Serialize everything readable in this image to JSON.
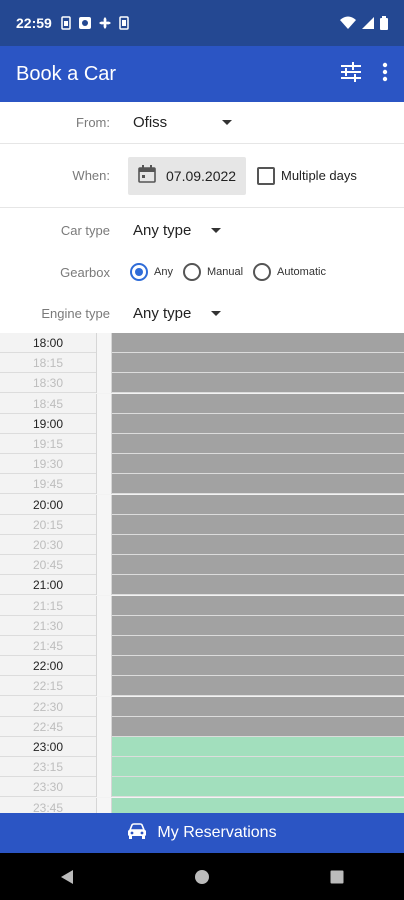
{
  "status_bar": {
    "time": "22:59"
  },
  "app_bar": {
    "title": "Book a Car",
    "filter_icon": "tune-icon",
    "menu_icon": "more-vert-icon"
  },
  "form": {
    "from_label": "From:",
    "from_value": "Ofiss",
    "when_label": "When:",
    "date_value": "07.09.2022",
    "multiple_days_label": "Multiple days",
    "car_type_label": "Car type",
    "car_type_value": "Any type",
    "gearbox_label": "Gearbox",
    "gearbox_options": [
      "Any",
      "Manual",
      "Automatic"
    ],
    "gearbox_selected": "Any",
    "engine_type_label": "Engine type",
    "engine_type_value": "Any type"
  },
  "schedule": {
    "colors": {
      "busy": "#a2a2a2",
      "free": "#a2dfbd"
    },
    "slots": [
      {
        "time": "18:00",
        "status": "busy"
      },
      {
        "time": "18:15",
        "status": "busy"
      },
      {
        "time": "18:30",
        "status": "busy"
      },
      {
        "time": "18:45",
        "status": "busy"
      },
      {
        "time": "19:00",
        "status": "busy"
      },
      {
        "time": "19:15",
        "status": "busy"
      },
      {
        "time": "19:30",
        "status": "busy"
      },
      {
        "time": "19:45",
        "status": "busy"
      },
      {
        "time": "20:00",
        "status": "busy"
      },
      {
        "time": "20:15",
        "status": "busy"
      },
      {
        "time": "20:30",
        "status": "busy"
      },
      {
        "time": "20:45",
        "status": "busy"
      },
      {
        "time": "21:00",
        "status": "busy"
      },
      {
        "time": "21:15",
        "status": "busy"
      },
      {
        "time": "21:30",
        "status": "busy"
      },
      {
        "time": "21:45",
        "status": "busy"
      },
      {
        "time": "22:00",
        "status": "busy"
      },
      {
        "time": "22:15",
        "status": "busy"
      },
      {
        "time": "22:30",
        "status": "busy"
      },
      {
        "time": "22:45",
        "status": "busy"
      },
      {
        "time": "23:00",
        "status": "free"
      },
      {
        "time": "23:15",
        "status": "free"
      },
      {
        "time": "23:30",
        "status": "free"
      },
      {
        "time": "23:45",
        "status": "free"
      }
    ]
  },
  "bottom_bar": {
    "label": "My Reservations",
    "icon": "car-icon"
  },
  "colors": {
    "app_bar": "#2b55c4",
    "status_bar": "#244892",
    "accent": "#2f6cd8"
  }
}
